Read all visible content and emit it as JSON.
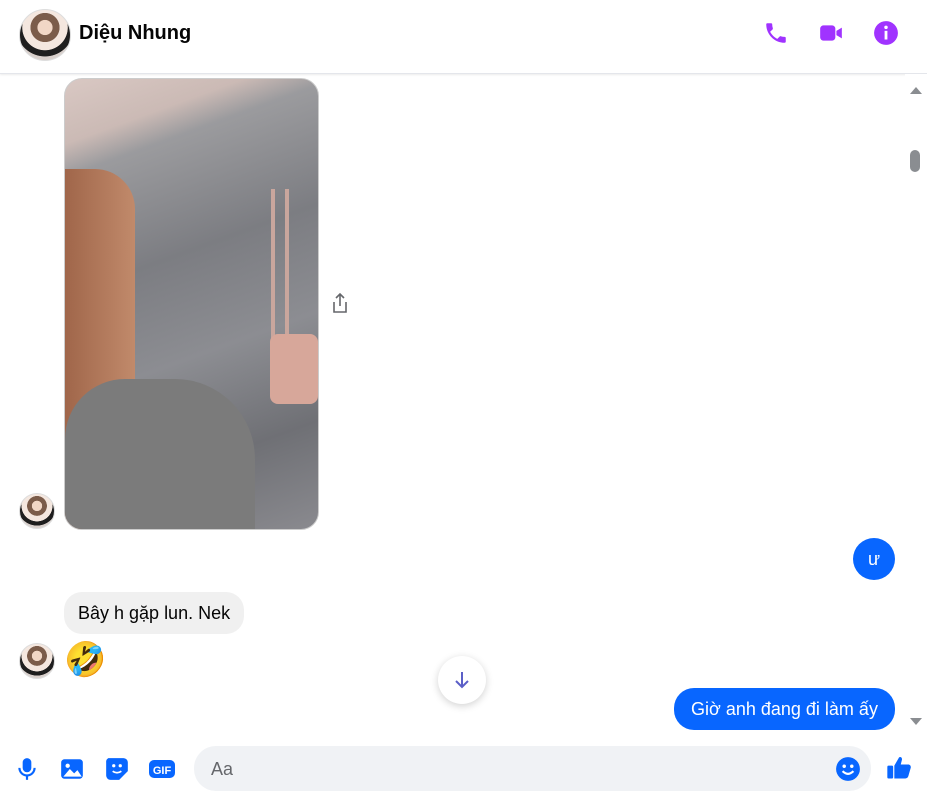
{
  "header": {
    "contact_name": "Diệu Nhung",
    "icons": [
      "phone-icon",
      "video-call-icon",
      "info-icon"
    ],
    "accent_color": "#a033ff"
  },
  "messages": [
    {
      "side": "in",
      "type": "image",
      "content": "photo"
    },
    {
      "side": "out",
      "type": "text",
      "text": "ư"
    },
    {
      "side": "in",
      "type": "text",
      "text": "Bây h gặp lun. Nek"
    },
    {
      "side": "in",
      "type": "emoji",
      "text": "🤣"
    },
    {
      "side": "out",
      "type": "text",
      "text": "Giờ anh đang đi làm ấy"
    }
  ],
  "composer": {
    "placeholder": "Aa",
    "value": "",
    "icons": [
      "microphone-icon",
      "image-icon",
      "sticker-icon",
      "gif-icon",
      "emoji-icon",
      "like-icon"
    ],
    "gif_label": "GIF",
    "accent_color": "#0866ff"
  },
  "colors": {
    "outgoing_bubble": "#0866ff",
    "incoming_bubble": "#f0f0f0"
  }
}
